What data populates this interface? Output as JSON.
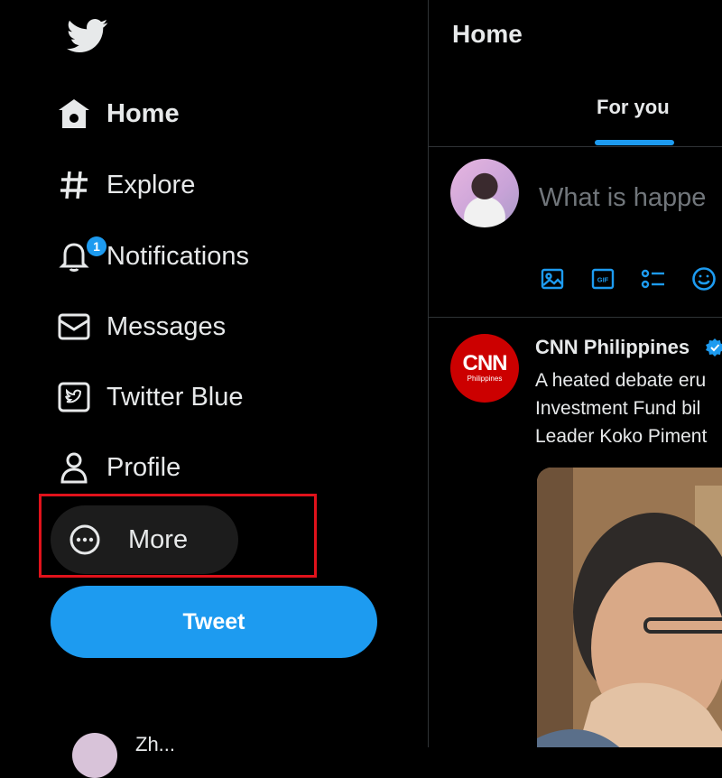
{
  "sidebar": {
    "logo": "twitter-bird-logo",
    "nav": [
      {
        "label": "Home",
        "icon": "home-icon",
        "active": true
      },
      {
        "label": "Explore",
        "icon": "hashtag-icon"
      },
      {
        "label": "Notifications",
        "icon": "bell-icon",
        "badge": "1"
      },
      {
        "label": "Messages",
        "icon": "envelope-icon"
      },
      {
        "label": "Twitter Blue",
        "icon": "twitter-blue-icon"
      },
      {
        "label": "Profile",
        "icon": "person-icon"
      },
      {
        "label": "More",
        "icon": "more-circle-icon"
      }
    ],
    "tweet_button": "Tweet",
    "account_name_partial": "Zh..."
  },
  "main": {
    "title": "Home",
    "tabs": [
      {
        "label": "For you",
        "active": true
      }
    ],
    "composer": {
      "placeholder": "What is happe",
      "tools": [
        "image-icon",
        "gif-icon",
        "poll-icon",
        "emoji-icon"
      ]
    },
    "tweet": {
      "author": "CNN Philippines",
      "avatar_text": "CNN",
      "avatar_subtext": "Philippines",
      "verified": true,
      "text_lines": [
        "A heated debate eru",
        "Investment Fund bil",
        "Leader Koko Piment"
      ]
    }
  },
  "colors": {
    "accent": "#1d9bf0",
    "background": "#000000",
    "highlight": "#e0121b",
    "cnn_red": "#cc0000"
  }
}
